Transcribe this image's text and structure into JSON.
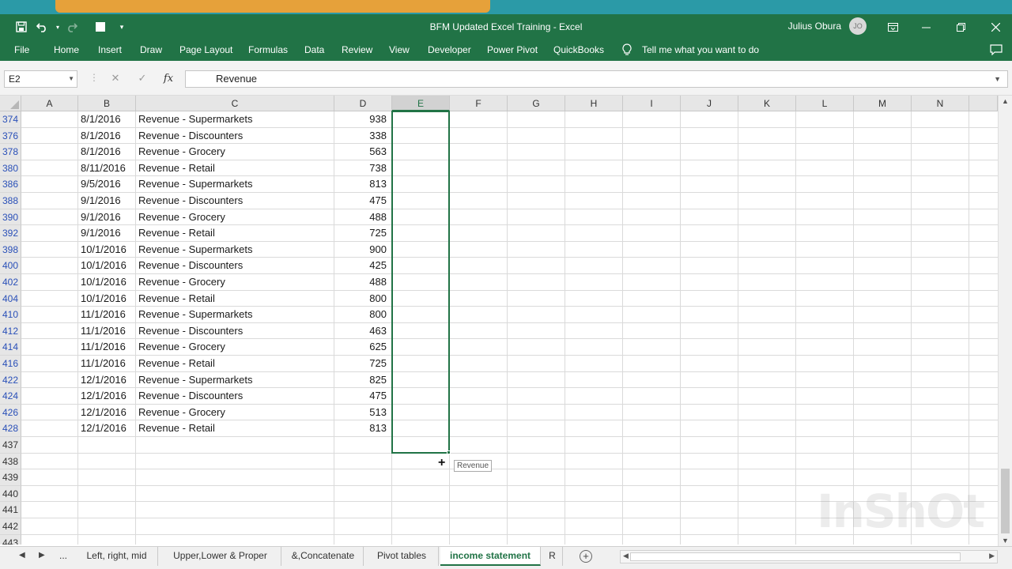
{
  "window": {
    "title": "BFM Updated Excel Training  -  Excel",
    "user_name": "Julius Obura",
    "user_initials": "JO"
  },
  "ribbon_tabs": [
    "File",
    "Home",
    "Insert",
    "Draw",
    "Page Layout",
    "Formulas",
    "Data",
    "Review",
    "View",
    "Developer",
    "Power Pivot",
    "QuickBooks"
  ],
  "tell_me": "Tell me what you want to do",
  "formula_bar": {
    "name_box": "E2",
    "fx_label": "fx",
    "content": "Revenue"
  },
  "columns": [
    "A",
    "B",
    "C",
    "D",
    "E",
    "F",
    "G",
    "H",
    "I",
    "J",
    "K",
    "L",
    "M",
    "N"
  ],
  "selected_column": "E",
  "rows": [
    {
      "num": "374",
      "date": "8/1/2016",
      "desc": "Revenue - Supermarkets",
      "value": "938",
      "filtered": true
    },
    {
      "num": "376",
      "date": "8/1/2016",
      "desc": "Revenue - Discounters",
      "value": "338",
      "filtered": true
    },
    {
      "num": "378",
      "date": "8/1/2016",
      "desc": "Revenue - Grocery",
      "value": "563",
      "filtered": true
    },
    {
      "num": "380",
      "date": "8/11/2016",
      "desc": "Revenue - Retail",
      "value": "738",
      "filtered": true
    },
    {
      "num": "386",
      "date": "9/5/2016",
      "desc": "Revenue - Supermarkets",
      "value": "813",
      "filtered": true
    },
    {
      "num": "388",
      "date": "9/1/2016",
      "desc": "Revenue - Discounters",
      "value": "475",
      "filtered": true
    },
    {
      "num": "390",
      "date": "9/1/2016",
      "desc": "Revenue - Grocery",
      "value": "488",
      "filtered": true
    },
    {
      "num": "392",
      "date": "9/1/2016",
      "desc": "Revenue - Retail",
      "value": "725",
      "filtered": true
    },
    {
      "num": "398",
      "date": "10/1/2016",
      "desc": "Revenue - Supermarkets",
      "value": "900",
      "filtered": true
    },
    {
      "num": "400",
      "date": "10/1/2016",
      "desc": "Revenue - Discounters",
      "value": "425",
      "filtered": true
    },
    {
      "num": "402",
      "date": "10/1/2016",
      "desc": "Revenue - Grocery",
      "value": "488",
      "filtered": true
    },
    {
      "num": "404",
      "date": "10/1/2016",
      "desc": "Revenue - Retail",
      "value": "800",
      "filtered": true
    },
    {
      "num": "410",
      "date": "11/1/2016",
      "desc": "Revenue - Supermarkets",
      "value": "800",
      "filtered": true
    },
    {
      "num": "412",
      "date": "11/1/2016",
      "desc": "Revenue - Discounters",
      "value": "463",
      "filtered": true
    },
    {
      "num": "414",
      "date": "11/1/2016",
      "desc": "Revenue - Grocery",
      "value": "625",
      "filtered": true
    },
    {
      "num": "416",
      "date": "11/1/2016",
      "desc": "Revenue - Retail",
      "value": "725",
      "filtered": true
    },
    {
      "num": "422",
      "date": "12/1/2016",
      "desc": "Revenue - Supermarkets",
      "value": "825",
      "filtered": true
    },
    {
      "num": "424",
      "date": "12/1/2016",
      "desc": "Revenue - Discounters",
      "value": "475",
      "filtered": true
    },
    {
      "num": "426",
      "date": "12/1/2016",
      "desc": "Revenue - Grocery",
      "value": "513",
      "filtered": true
    },
    {
      "num": "428",
      "date": "12/1/2016",
      "desc": "Revenue - Retail",
      "value": "813",
      "filtered": true
    },
    {
      "num": "437",
      "date": "",
      "desc": "",
      "value": "",
      "filtered": false
    },
    {
      "num": "438",
      "date": "",
      "desc": "",
      "value": "",
      "filtered": false
    },
    {
      "num": "439",
      "date": "",
      "desc": "",
      "value": "",
      "filtered": false
    },
    {
      "num": "440",
      "date": "",
      "desc": "",
      "value": "",
      "filtered": false
    },
    {
      "num": "441",
      "date": "",
      "desc": "",
      "value": "",
      "filtered": false
    },
    {
      "num": "442",
      "date": "",
      "desc": "",
      "value": "",
      "filtered": false
    },
    {
      "num": "443",
      "date": "",
      "desc": "",
      "value": "",
      "filtered": false
    }
  ],
  "drag_tooltip": "Revenue",
  "watermark": "InShOt",
  "sheet_tabs": [
    "...",
    "Left, right, mid",
    "Upper,Lower & Proper",
    "&,Concatenate",
    "Pivot tables",
    "income statement",
    "R"
  ],
  "active_sheet": "income statement",
  "colors": {
    "excel_green": "#217346",
    "filtered_row_number": "#2a50b8",
    "banner_teal": "#2b9aa7",
    "banner_orange": "#f0a134"
  }
}
